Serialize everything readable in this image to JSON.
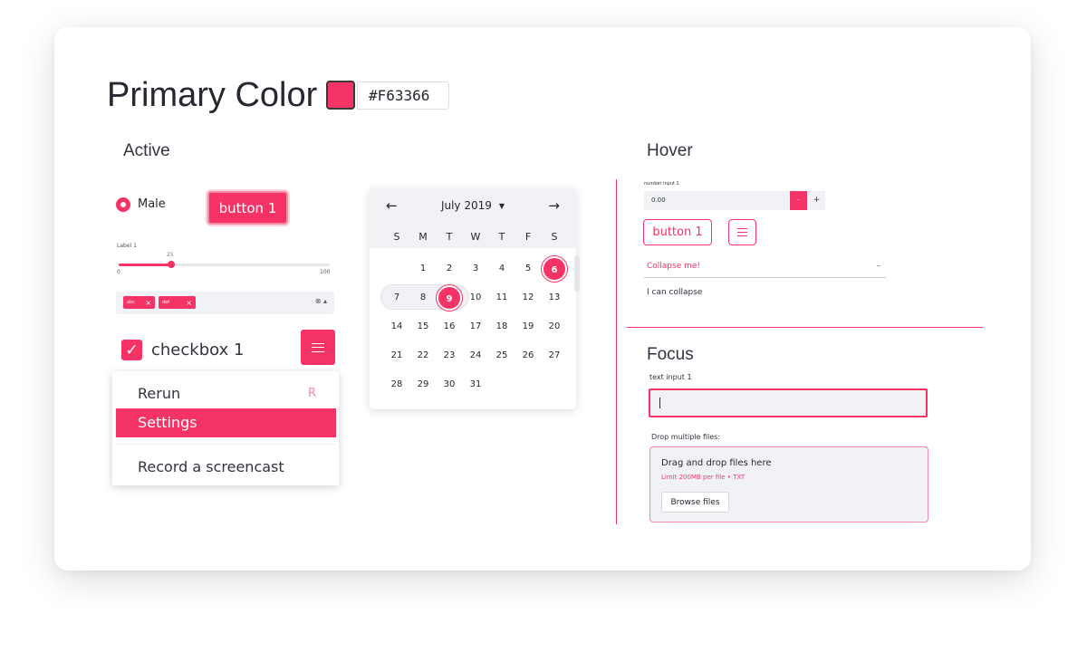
{
  "theme": {
    "primary": "#F63366"
  },
  "header": {
    "title": "Primary Color",
    "color_hex": "#F63366"
  },
  "active": {
    "heading": "Active",
    "radio": {
      "label": "Male",
      "selected": true
    },
    "button_label": "button 1",
    "slider": {
      "label": "Label 1",
      "value": 25,
      "min": 0,
      "max": 100,
      "value_text": "25",
      "min_text": "0",
      "max_text": "100"
    },
    "multiselect": {
      "tags": [
        "abc",
        "def"
      ],
      "clear_icon": "x-icon",
      "dropdown_icon": "chevron-down-icon"
    },
    "checkbox": {
      "label": "checkbox 1",
      "checked": true
    },
    "menu": {
      "items": [
        {
          "label": "Rerun",
          "shortcut": "R"
        },
        {
          "label": "Settings",
          "highlighted": true
        },
        {
          "label": "Record a screencast"
        }
      ]
    }
  },
  "calendar": {
    "month": "July 2019",
    "prev_icon": "←",
    "next_icon": "→",
    "weekdays": [
      "S",
      "M",
      "T",
      "W",
      "T",
      "F",
      "S"
    ],
    "days": [
      "1",
      "2",
      "3",
      "4",
      "5",
      "6",
      "7",
      "8",
      "9",
      "10",
      "11",
      "12",
      "13",
      "14",
      "15",
      "16",
      "17",
      "18",
      "19",
      "20",
      "21",
      "22",
      "23",
      "24",
      "25",
      "26",
      "27",
      "28",
      "29",
      "30",
      "31"
    ],
    "selected_days": [
      6,
      9
    ]
  },
  "hover": {
    "heading": "Hover",
    "number_input": {
      "label": "number input 1",
      "value": "0.00",
      "minus": "-",
      "plus": "+"
    },
    "button_label": "button 1",
    "expander": {
      "title": "Collapse me!",
      "toggle": "–",
      "body": "I can collapse"
    }
  },
  "focus": {
    "heading": "Focus",
    "text_input": {
      "label": "text input 1",
      "value": ""
    },
    "file_uploader": {
      "label": "Drop multiple files:",
      "title": "Drag and drop files here",
      "subtitle": "Limit 200MB per file • TXT",
      "button": "Browse files"
    }
  }
}
